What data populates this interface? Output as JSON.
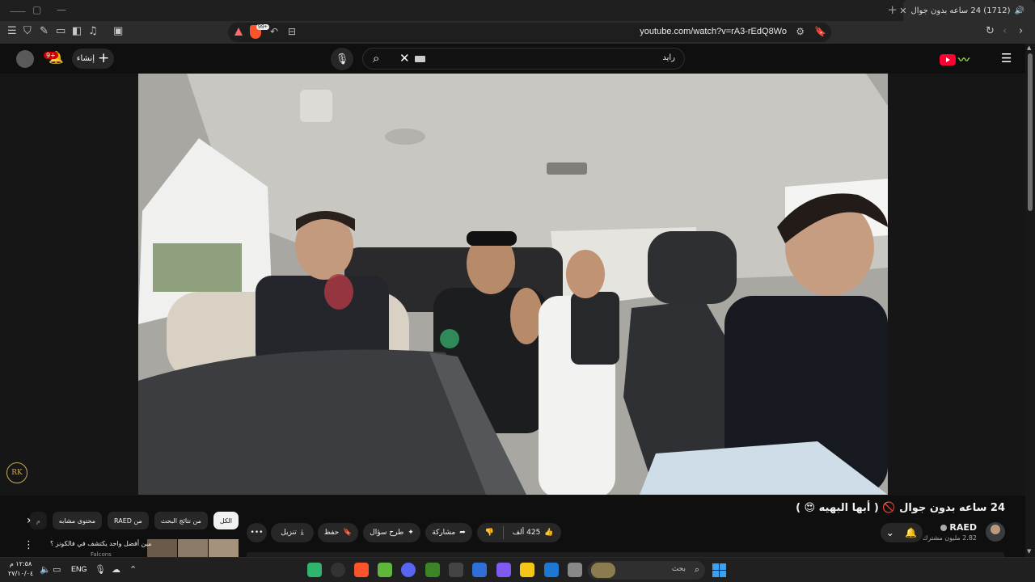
{
  "browser": {
    "tab": {
      "title": "(1712) 24 ساعه بدون جوال"
    },
    "url": "youtube.com/watch?v=rA3-rEdQ8Wo",
    "brave_badge": "99+"
  },
  "masthead": {
    "create_label": "إنشاء",
    "notification_count": "9+",
    "search_value": "رايد"
  },
  "player": {
    "corner_logo": "RK"
  },
  "video": {
    "title": "24 ساعه بدون جوال 🚫 ( أبها البهيه 😍 )",
    "channel_name": "RAED",
    "subscribers": "2.82 مليون مشترك",
    "likes": "425 ألف",
    "share_label": "مشاركة",
    "ask_label": "طرح سؤال",
    "save_label": "حفظ",
    "download_label": "تنزيل"
  },
  "chips": [
    {
      "label": "الكل",
      "active": true
    },
    {
      "label": "من نتائج البحث",
      "active": false
    },
    {
      "label": "من RAED",
      "active": false
    },
    {
      "label": "محتوى مشابه",
      "active": false
    },
    {
      "label": "م",
      "active": false
    }
  ],
  "recommendation": {
    "title": "مين أفضل واحد يكتشف في فالكونز ؟",
    "channel": "Falcons"
  },
  "taskbar": {
    "time": "١٢:٥٨ م",
    "date": "٢٧/١٠/٠٤",
    "language": "ENG",
    "search_placeholder": "بحث"
  },
  "colors": {
    "youtube_red": "#ff0033",
    "chip_bg": "#272727",
    "page_bg": "#0f0f0f"
  }
}
